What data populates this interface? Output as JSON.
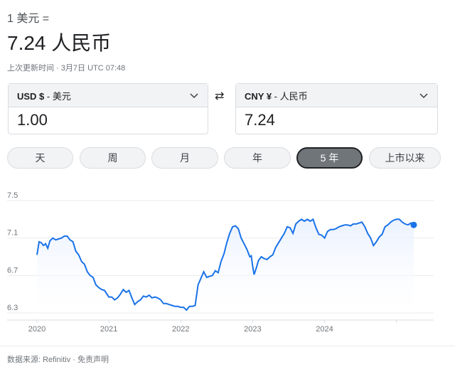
{
  "header": {
    "base_line": "1 美元 =",
    "rate_line": "7.24 人民币",
    "updated": "上次更新时间 · 3月7日 UTC 07:48"
  },
  "converter": {
    "from": {
      "currency_code": "USD $",
      "currency_name": " - 美元",
      "amount": "1.00"
    },
    "to": {
      "currency_code": "CNY ¥",
      "currency_name": " - 人民币",
      "amount": "7.24"
    },
    "swap_icon": "⇄"
  },
  "range_tabs": [
    {
      "label": "天",
      "active": false
    },
    {
      "label": "周",
      "active": false
    },
    {
      "label": "月",
      "active": false
    },
    {
      "label": "年",
      "active": false
    },
    {
      "label": "5 年",
      "active": true
    },
    {
      "label": "上市以来",
      "active": false
    }
  ],
  "chart_data": {
    "type": "area",
    "title": "",
    "xlabel": "",
    "ylabel": "",
    "ylim": [
      6.3,
      7.5
    ],
    "yticks": [
      "7.5",
      "7.1",
      "6.7",
      "6.3"
    ],
    "xticks": [
      "2020",
      "2021",
      "2022",
      "2023",
      "2024"
    ],
    "x_start": 2020.0,
    "x_end": 2025.27,
    "line_color": "#1a73e8",
    "series": [
      {
        "points": [
          [
            2020.0,
            6.92
          ],
          [
            2020.03,
            7.06
          ],
          [
            2020.06,
            7.05
          ],
          [
            2020.09,
            7.02
          ],
          [
            2020.12,
            7.04
          ],
          [
            2020.15,
            6.99
          ],
          [
            2020.18,
            7.07
          ],
          [
            2020.22,
            7.1
          ],
          [
            2020.26,
            7.08
          ],
          [
            2020.3,
            7.09
          ],
          [
            2020.34,
            7.1
          ],
          [
            2020.38,
            7.12
          ],
          [
            2020.42,
            7.12
          ],
          [
            2020.46,
            7.08
          ],
          [
            2020.5,
            7.06
          ],
          [
            2020.54,
            6.96
          ],
          [
            2020.58,
            6.92
          ],
          [
            2020.62,
            6.85
          ],
          [
            2020.66,
            6.82
          ],
          [
            2020.7,
            6.74
          ],
          [
            2020.74,
            6.7
          ],
          [
            2020.78,
            6.68
          ],
          [
            2020.82,
            6.6
          ],
          [
            2020.86,
            6.57
          ],
          [
            2020.9,
            6.55
          ],
          [
            2020.94,
            6.54
          ],
          [
            2021.0,
            6.47
          ],
          [
            2021.04,
            6.47
          ],
          [
            2021.08,
            6.44
          ],
          [
            2021.12,
            6.46
          ],
          [
            2021.16,
            6.5
          ],
          [
            2021.2,
            6.55
          ],
          [
            2021.24,
            6.52
          ],
          [
            2021.28,
            6.54
          ],
          [
            2021.32,
            6.46
          ],
          [
            2021.36,
            6.39
          ],
          [
            2021.4,
            6.42
          ],
          [
            2021.44,
            6.44
          ],
          [
            2021.48,
            6.48
          ],
          [
            2021.52,
            6.47
          ],
          [
            2021.56,
            6.49
          ],
          [
            2021.6,
            6.46
          ],
          [
            2021.64,
            6.47
          ],
          [
            2021.68,
            6.46
          ],
          [
            2021.72,
            6.44
          ],
          [
            2021.76,
            6.4
          ],
          [
            2021.8,
            6.4
          ],
          [
            2021.84,
            6.39
          ],
          [
            2021.88,
            6.38
          ],
          [
            2021.92,
            6.37
          ],
          [
            2021.96,
            6.37
          ],
          [
            2022.0,
            6.36
          ],
          [
            2022.04,
            6.36
          ],
          [
            2022.08,
            6.33
          ],
          [
            2022.12,
            6.37
          ],
          [
            2022.16,
            6.37
          ],
          [
            2022.2,
            6.38
          ],
          [
            2022.24,
            6.6
          ],
          [
            2022.28,
            6.67
          ],
          [
            2022.32,
            6.74
          ],
          [
            2022.36,
            6.68
          ],
          [
            2022.4,
            6.69
          ],
          [
            2022.44,
            6.7
          ],
          [
            2022.48,
            6.75
          ],
          [
            2022.52,
            6.73
          ],
          [
            2022.56,
            6.85
          ],
          [
            2022.6,
            6.93
          ],
          [
            2022.64,
            7.05
          ],
          [
            2022.68,
            7.15
          ],
          [
            2022.72,
            7.22
          ],
          [
            2022.76,
            7.23
          ],
          [
            2022.8,
            7.2
          ],
          [
            2022.84,
            7.1
          ],
          [
            2022.88,
            7.04
          ],
          [
            2022.92,
            6.98
          ],
          [
            2022.96,
            6.9
          ],
          [
            2022.98,
            6.91
          ],
          [
            2023.0,
            6.8
          ],
          [
            2023.02,
            6.71
          ],
          [
            2023.05,
            6.78
          ],
          [
            2023.08,
            6.86
          ],
          [
            2023.12,
            6.9
          ],
          [
            2023.16,
            6.88
          ],
          [
            2023.2,
            6.87
          ],
          [
            2023.24,
            6.9
          ],
          [
            2023.28,
            6.92
          ],
          [
            2023.32,
            7.0
          ],
          [
            2023.36,
            7.05
          ],
          [
            2023.4,
            7.1
          ],
          [
            2023.44,
            7.15
          ],
          [
            2023.48,
            7.22
          ],
          [
            2023.52,
            7.21
          ],
          [
            2023.56,
            7.15
          ],
          [
            2023.6,
            7.25
          ],
          [
            2023.64,
            7.28
          ],
          [
            2023.68,
            7.3
          ],
          [
            2023.72,
            7.28
          ],
          [
            2023.76,
            7.3
          ],
          [
            2023.8,
            7.28
          ],
          [
            2023.84,
            7.3
          ],
          [
            2023.88,
            7.21
          ],
          [
            2023.92,
            7.14
          ],
          [
            2023.96,
            7.13
          ],
          [
            2024.0,
            7.1
          ],
          [
            2024.04,
            7.17
          ],
          [
            2024.08,
            7.19
          ],
          [
            2024.12,
            7.19
          ],
          [
            2024.16,
            7.2
          ],
          [
            2024.2,
            7.22
          ],
          [
            2024.24,
            7.23
          ],
          [
            2024.28,
            7.24
          ],
          [
            2024.32,
            7.24
          ],
          [
            2024.36,
            7.23
          ],
          [
            2024.4,
            7.25
          ],
          [
            2024.44,
            7.25
          ],
          [
            2024.48,
            7.26
          ],
          [
            2024.52,
            7.27
          ],
          [
            2024.56,
            7.22
          ],
          [
            2024.6,
            7.15
          ],
          [
            2024.64,
            7.1
          ],
          [
            2024.68,
            7.02
          ],
          [
            2024.72,
            7.06
          ],
          [
            2024.76,
            7.11
          ],
          [
            2024.8,
            7.14
          ],
          [
            2024.84,
            7.22
          ],
          [
            2024.88,
            7.24
          ],
          [
            2024.92,
            7.27
          ],
          [
            2024.96,
            7.29
          ],
          [
            2025.0,
            7.3
          ],
          [
            2025.04,
            7.3
          ],
          [
            2025.08,
            7.27
          ],
          [
            2025.12,
            7.25
          ],
          [
            2025.16,
            7.24
          ],
          [
            2025.2,
            7.26
          ],
          [
            2025.24,
            7.24
          ]
        ]
      }
    ],
    "last_point": [
      2025.24,
      7.24
    ],
    "grid": true
  },
  "footer": {
    "source": "数据来源: Refinitiv",
    "separator": " · ",
    "disclaimer": "免责声明"
  }
}
